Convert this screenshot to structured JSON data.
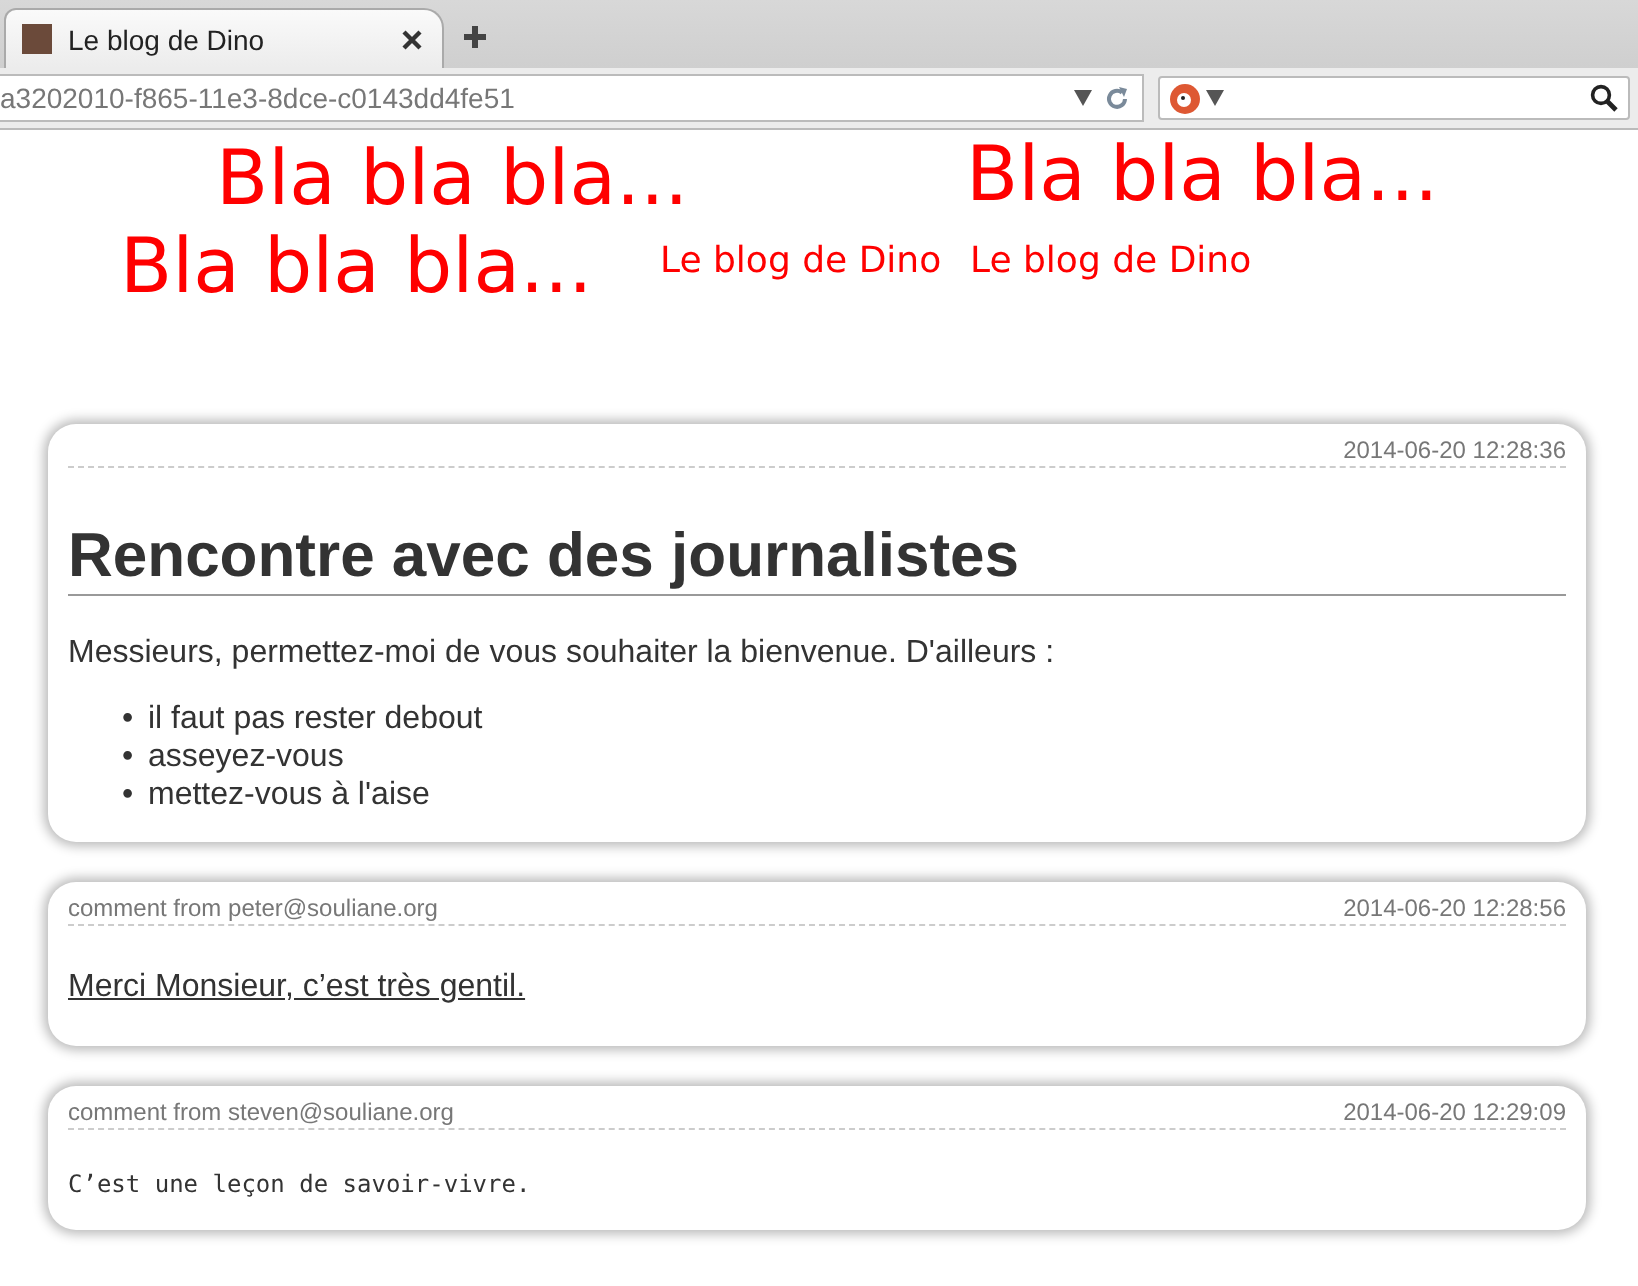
{
  "browser": {
    "tab": {
      "title": "Le blog de Dino"
    },
    "address": "a3202010-f865-11e3-8dce-c0143dd4fe51"
  },
  "banner": [
    {
      "text": "Bla bla bla...",
      "kind": "big"
    },
    {
      "text": "Bla bla bla...",
      "kind": "big"
    },
    {
      "text": "Bla bla bla...",
      "kind": "big"
    },
    {
      "text": "Le blog de Dino",
      "kind": "small"
    },
    {
      "text": "Le blog de Dino",
      "kind": "small"
    }
  ],
  "post": {
    "date": "2014-06-20 12:28:36",
    "title": "Rencontre avec des journalistes",
    "intro": "Messieurs, permettez-moi de vous souhaiter la bienvenue. D'ailleurs :",
    "items": [
      {
        "marker": "•",
        "text": "il faut pas rester debout"
      },
      {
        "marker": "•",
        "text": "asseyez-vous"
      },
      {
        "marker": "•",
        "text": "mettez-vous à l'aise"
      }
    ]
  },
  "comments": [
    {
      "author": "comment from peter@souliane.org",
      "date": "2014-06-20 12:28:56",
      "text": "Merci Monsieur, c’est très gentil.",
      "kind": "link"
    },
    {
      "author": "comment from steven@souliane.org",
      "date": "2014-06-20 12:29:09",
      "text": "C’est une leçon de savoir-vivre.",
      "kind": "mono"
    }
  ]
}
